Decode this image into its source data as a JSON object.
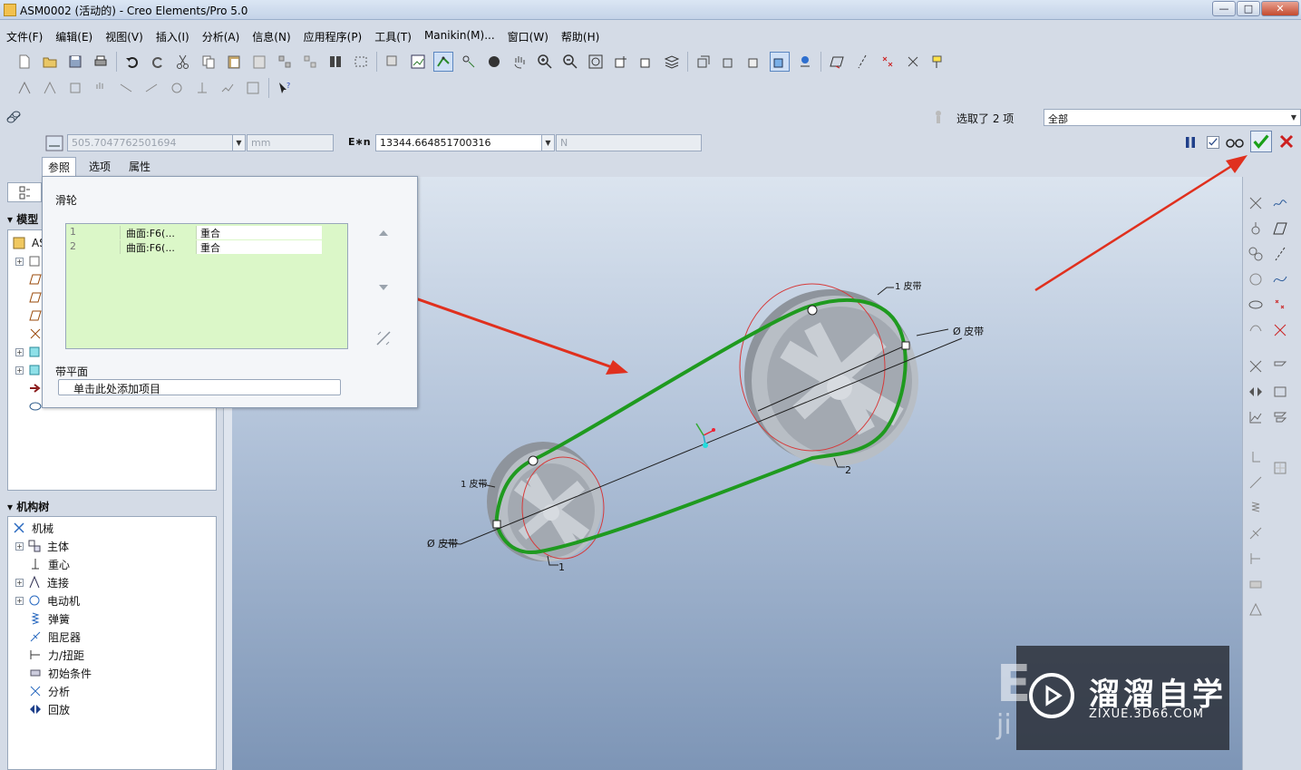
{
  "window": {
    "title": "ASM0002 (活动的) - Creo Elements/Pro 5.0",
    "minimize": "—",
    "maximize": "□",
    "close": "✕"
  },
  "menu": [
    "文件(F)",
    "编辑(E)",
    "视图(V)",
    "插入(I)",
    "分析(A)",
    "信息(N)",
    "应用程序(P)",
    "工具(T)",
    "Manikin(M)...",
    "窗口(W)",
    "帮助(H)"
  ],
  "dashboard": {
    "field1_value": "505.7047762501694",
    "field1_unit": "mm",
    "e_label": "E∗n",
    "field2_value": "13344.664851700316",
    "field2_unit": "N",
    "selected_label": "选取了 2 项",
    "filter_value": "全部",
    "tabs": [
      "参照",
      "选项",
      "属性"
    ]
  },
  "ref_panel": {
    "title": "滑轮",
    "rows": [
      {
        "num": "1",
        "surface": "曲面:F6(...",
        "constraint": "重合"
      },
      {
        "num": "2",
        "surface": "曲面:F6(...",
        "constraint": "重合"
      }
    ],
    "belt_plane_label": "带平面",
    "add_item": "单击此处添加项目"
  },
  "model_tree": {
    "heading": "模型",
    "root": "AS"
  },
  "mech_tree": {
    "heading": "机构树",
    "root": "机械",
    "items": [
      "主体",
      "重心",
      "连接",
      "电动机",
      "弹簧",
      "阻尼器",
      "力/扭距",
      "初始条件",
      "分析",
      "回放"
    ]
  },
  "viewport": {
    "labels": {
      "large_belt_tag": "1 皮带",
      "large_dia_tag": "Ø 皮带",
      "large_idx": "2",
      "small_belt_tag": "1 皮带",
      "small_dia_tag": "Ø 皮带",
      "small_idx": "1"
    }
  },
  "watermark": {
    "title": "溜溜自学",
    "url": "ZIXUE.3D66.COM",
    "bg_text": "E",
    "bg_text2": "ji"
  },
  "colors": {
    "belt": "#1f9a1f",
    "arrow": "#e0301e",
    "ok_green": "#1aa01a",
    "cancel_red": "#cc1f1f"
  },
  "icons": [
    "new-icon",
    "open-icon",
    "save-icon",
    "print-icon",
    "undo-icon",
    "redo-icon",
    "cut-icon",
    "copy-icon",
    "paste-icon",
    "spin-icon",
    "zoom-in-icon",
    "zoom-out-icon",
    "refit-icon",
    "pause-icon",
    "preview-icon",
    "confirm-icon",
    "cancel-icon"
  ]
}
